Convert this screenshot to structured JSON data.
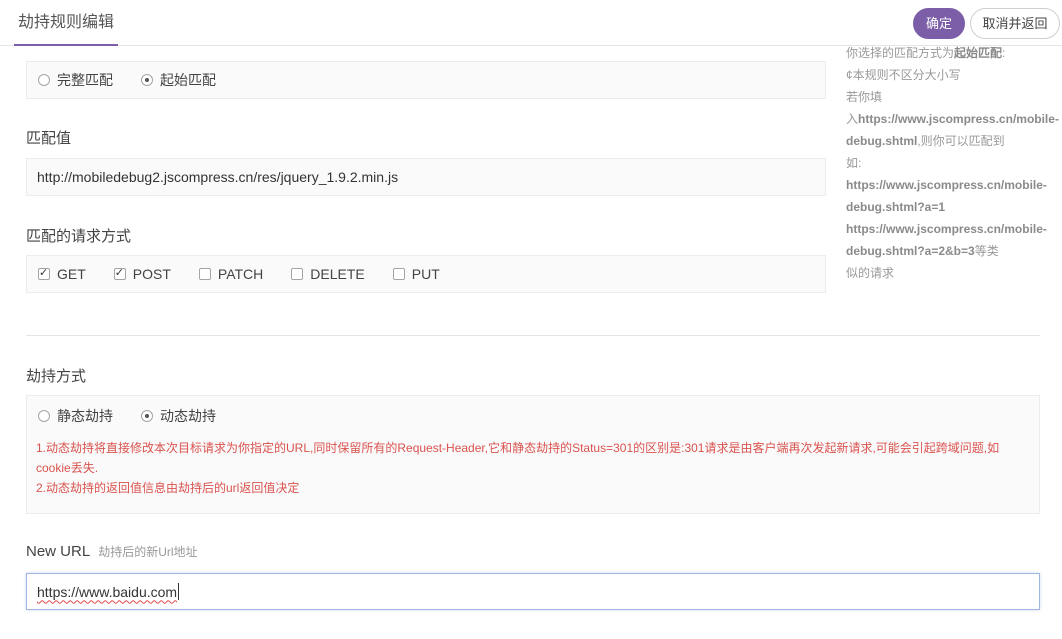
{
  "header": {
    "title": "劫持规则编辑",
    "confirm_label": "确定",
    "cancel_label": "取消并返回"
  },
  "match_type": {
    "options": [
      {
        "label": "完整匹配",
        "checked": false
      },
      {
        "label": "起始匹配",
        "checked": true
      }
    ]
  },
  "match_value": {
    "label": "匹配值",
    "value": "http://mobiledebug2.jscompress.cn/res/jquery_1.9.2.min.js"
  },
  "methods": {
    "label": "匹配的请求方式",
    "options": [
      {
        "label": "GET",
        "checked": true
      },
      {
        "label": "POST",
        "checked": true
      },
      {
        "label": "PATCH",
        "checked": false
      },
      {
        "label": "DELETE",
        "checked": false
      },
      {
        "label": "PUT",
        "checked": false
      }
    ]
  },
  "hint": {
    "line1_prefix": "你选择的匹配方式为",
    "line1_bold": "起始匹配",
    "line1_suffix": ":",
    "line2": "¢本规则不区分大小写",
    "line3": "若你填",
    "line4_prefix": "入",
    "line4_bold": "https://www.jscompress.cn/mobile-",
    "line5_bold": "debug.shtml",
    "line5_suffix": ",则你可以匹配到",
    "line6": "如:",
    "line7_bold": "https://www.jscompress.cn/mobile-",
    "line8_bold": "debug.shtml?a=1",
    "line9_bold": "https://www.jscompress.cn/mobile-",
    "line10_bold": "debug.shtml?a=2&b=3",
    "line10_suffix": "等类",
    "line11": "似的请求"
  },
  "hijack": {
    "label": "劫持方式",
    "options": [
      {
        "label": "静态劫持",
        "checked": false
      },
      {
        "label": "动态劫持",
        "checked": true
      }
    ],
    "note1": "1.动态劫持将直接修改本次目标请求为你指定的URL,同时保留所有的Request-Header,它和静态劫持的Status=301的区别是:301请求是由客户端再次发起新请求,可能会引起跨域问题,如",
    "note1b": "cookie丢失.",
    "note2": "2.动态劫持的返回值信息由劫持后的url返回值决定"
  },
  "new_url": {
    "label": "New URL",
    "sublabel": "劫持后的新Url地址",
    "value": "https://www.baidu.com"
  },
  "colors": {
    "accent": "#7b5ea7",
    "note_text": "#d9534f"
  }
}
